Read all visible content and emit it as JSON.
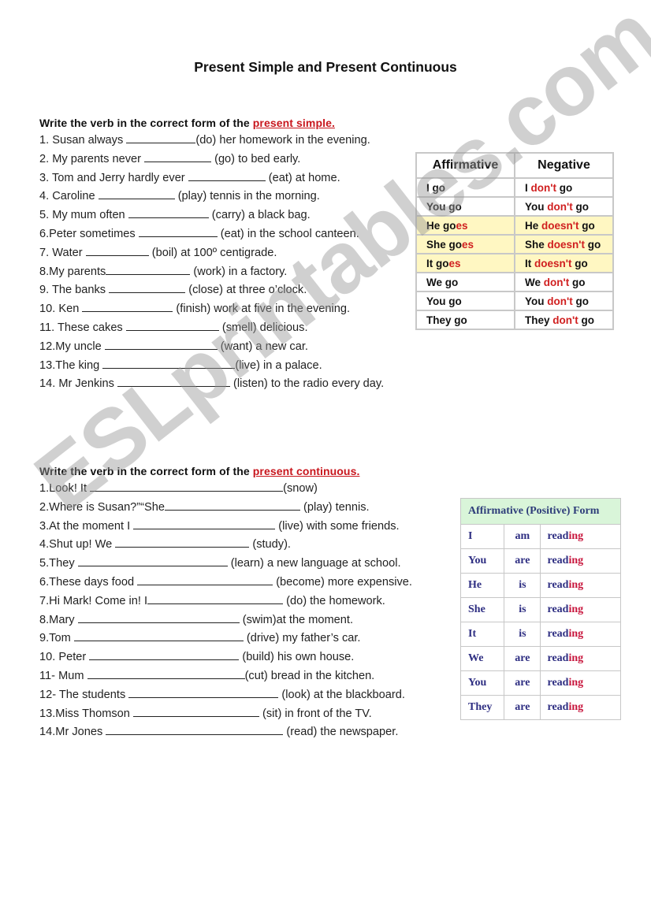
{
  "title": "Present Simple and Present Continuous",
  "section1": {
    "instruction_prefix": "Write the verb in the correct form of the ",
    "instruction_highlight": "present simple.",
    "items": [
      {
        "pre": "1. Susan always ",
        "post": "(do) her homework in the evening."
      },
      {
        "pre": "2. My parents never ",
        "post": " (go) to bed early."
      },
      {
        "pre": "3. Tom and Jerry hardly ever ",
        "post": " (eat) at home."
      },
      {
        "pre": "4. Caroline ",
        "post": " (play) tennis in the morning."
      },
      {
        "pre": "5. My mum often ",
        "post": " (carry) a black bag."
      },
      {
        "pre": "6.Peter sometimes ",
        "post": " (eat) in the school canteen."
      },
      {
        "pre": "7. Water ",
        "post": " (boil) at 100º centigrade."
      },
      {
        "pre": "8.My parents",
        "post": " (work) in a factory."
      },
      {
        "pre": "9. The banks ",
        "post": " (close) at three o’clock."
      },
      {
        "pre": "10. Ken ",
        "post": " (finish) work at five in the evening."
      },
      {
        "pre": "11. These cakes ",
        "post": " (smell) delicious."
      },
      {
        "pre": "12.My uncle ",
        "post": " (want) a new car."
      },
      {
        "pre": "13.The king ",
        "post": "(live) in a palace."
      },
      {
        "pre": "14. Mr Jenkins ",
        "post": " (listen) to the radio every day."
      }
    ]
  },
  "section2": {
    "instruction_prefix": "Write the verb in the correct form of the ",
    "instruction_highlight": "present continuous.",
    "items": [
      {
        "pre": "1.Look! It ",
        "post": "(snow)"
      },
      {
        "pre": "2.Where is Susan?”“She",
        "post": " (play) tennis."
      },
      {
        "pre": "3.At the moment I ",
        "post": " (live) with some friends."
      },
      {
        "pre": "4.Shut up! We ",
        "post": " (study)."
      },
      {
        "pre": "5.They ",
        "post": " (learn) a new language at school."
      },
      {
        "pre": "6.These days food ",
        "post": " (become) more expensive."
      },
      {
        "pre": "7.Hi Mark! Come in! I",
        "post": " (do) the homework."
      },
      {
        "pre": "8.Mary ",
        "post": " (swim)at the moment."
      },
      {
        "pre": "9.Tom ",
        "post": " (drive) my father’s car."
      },
      {
        "pre": "10. Peter ",
        "post": " (build) his own house."
      },
      {
        "pre": "11- Mum ",
        "post": "(cut) bread in the kitchen."
      },
      {
        "pre": "12- The students ",
        "post": " (look) at the blackboard."
      },
      {
        "pre": "13.Miss Thomson ",
        "post": " (sit) in front of the TV."
      },
      {
        "pre": "14.Mr Jones ",
        "post": " (read) the newspaper."
      }
    ]
  },
  "simple_table": {
    "headers": [
      "Affirmative",
      "Negative"
    ],
    "rows": [
      {
        "a_subj": "I go",
        "a_end": "",
        "n_subj": "I ",
        "n_aux": "don't",
        "n_verb": " go",
        "highlight": false
      },
      {
        "a_subj": "You go",
        "a_end": "",
        "n_subj": "You ",
        "n_aux": "don't",
        "n_verb": " go",
        "highlight": false
      },
      {
        "a_subj": "He go",
        "a_end": "es",
        "n_subj": "He ",
        "n_aux": "doesn't",
        "n_verb": " go",
        "highlight": true
      },
      {
        "a_subj": "She go",
        "a_end": "es",
        "n_subj": "She ",
        "n_aux": "doesn't",
        "n_verb": " go",
        "highlight": true
      },
      {
        "a_subj": "It go",
        "a_end": "es",
        "n_subj": "It ",
        "n_aux": "doesn't",
        "n_verb": " go",
        "highlight": true
      },
      {
        "a_subj": "We go",
        "a_end": "",
        "n_subj": "We ",
        "n_aux": "don't",
        "n_verb": " go",
        "highlight": false
      },
      {
        "a_subj": "You go",
        "a_end": "",
        "n_subj": "You ",
        "n_aux": "don't",
        "n_verb": " go",
        "highlight": false
      },
      {
        "a_subj": "They go",
        "a_end": "",
        "n_subj": "They ",
        "n_aux": "don't",
        "n_verb": " go",
        "highlight": false
      }
    ]
  },
  "continuous_table": {
    "header": "Affirmative (Positive) Form",
    "rows": [
      {
        "subj": "I",
        "aux": "am",
        "stem": "read",
        "ending": "ing"
      },
      {
        "subj": "You",
        "aux": "are",
        "stem": "read",
        "ending": "ing"
      },
      {
        "subj": "He",
        "aux": "is",
        "stem": "read",
        "ending": "ing"
      },
      {
        "subj": "She",
        "aux": "is",
        "stem": "read",
        "ending": "ing"
      },
      {
        "subj": "It",
        "aux": "is",
        "stem": "read",
        "ending": "ing"
      },
      {
        "subj": "We",
        "aux": "are",
        "stem": "read",
        "ending": "ing"
      },
      {
        "subj": "You",
        "aux": "are",
        "stem": "read",
        "ending": "ing"
      },
      {
        "subj": "They",
        "aux": "are",
        "stem": "read",
        "ending": "ing"
      }
    ]
  },
  "watermark": "ESLprintables.com",
  "colors": {
    "highlight_red": "#c8161d",
    "table_yellow": "#fff7c2",
    "table_green": "#d9f5d9",
    "table_blue_text": "#2e2e82"
  }
}
